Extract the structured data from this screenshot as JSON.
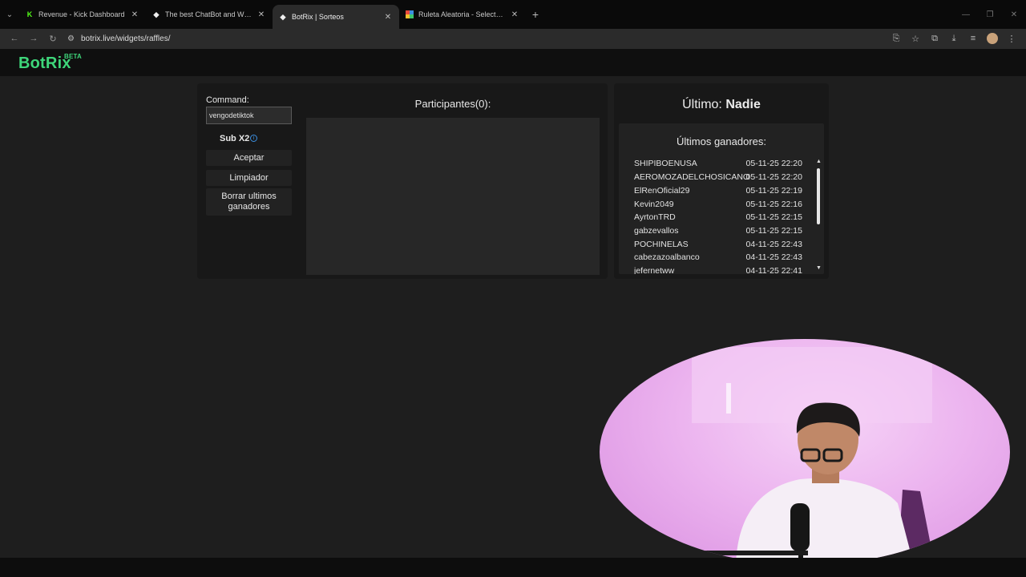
{
  "browser": {
    "tabs": [
      {
        "title": "Revenue - Kick Dashboard",
        "favicon": "kick-icon",
        "active": false
      },
      {
        "title": "The best ChatBot and Widgets",
        "favicon": "botrix-icon",
        "active": false
      },
      {
        "title": "BotRix | Sorteos",
        "favicon": "botrix-icon",
        "active": true
      },
      {
        "title": "Ruleta Aleatoria - Selector Pers",
        "favicon": "wheel-icon",
        "active": false
      }
    ],
    "url": "botrix.live/widgets/raffles/"
  },
  "site": {
    "logo": "BotRix",
    "logo_badge": "BETA",
    "brand_color": "#3ed67a"
  },
  "raffle": {
    "command_label": "Command:",
    "command_value": "vengodetiktok",
    "sub_label": "Sub X2",
    "sub_checked": false,
    "accept_label": "Aceptar",
    "clean_label": "Limpiador",
    "delete_label": "Borrar ultimos ganadores",
    "participants_title": "Participantes(0):"
  },
  "winners": {
    "last_prefix": "Último:",
    "last_value": "Nadie",
    "title": "Últimos ganadores:",
    "rows": [
      {
        "name": "SHIPIBOENUSA",
        "date": "05-11-25 22:20"
      },
      {
        "name": "AEROMOZADELCHOSICANO",
        "date": "05-11-25 22:20"
      },
      {
        "name": "ElRenOficial29",
        "date": "05-11-25 22:19"
      },
      {
        "name": "Kevin2049",
        "date": "05-11-25 22:16"
      },
      {
        "name": "AyrtonTRD",
        "date": "05-11-25 22:15"
      },
      {
        "name": "gabzevallos",
        "date": "05-11-25 22:15"
      },
      {
        "name": "POCHINELAS",
        "date": "04-11-25 22:43"
      },
      {
        "name": "cabezazoalbanco",
        "date": "04-11-25 22:43"
      },
      {
        "name": "jefernetww",
        "date": "04-11-25 22:41"
      }
    ]
  }
}
